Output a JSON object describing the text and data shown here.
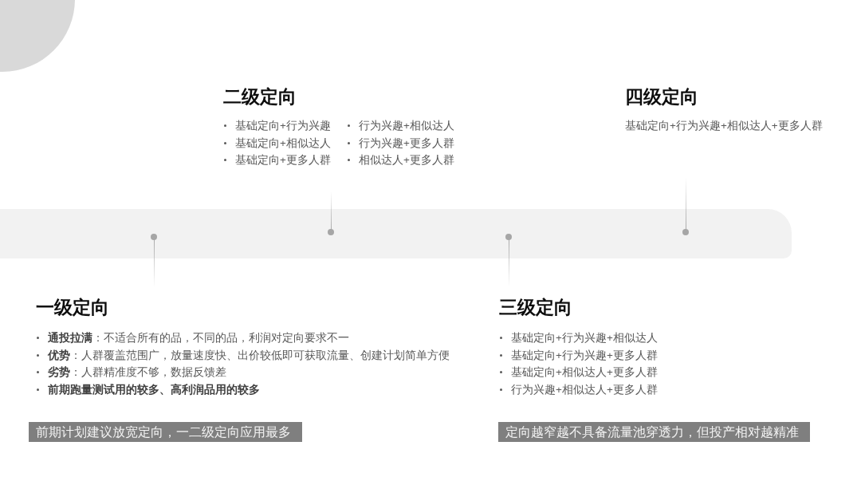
{
  "upper_stages": [
    {
      "title": "二级定向",
      "columns": [
        [
          "基础定向+行为兴趣",
          "基础定向+相似达人",
          "基础定向+更多人群"
        ],
        [
          "行为兴趣+相似达人",
          "行为兴趣+更多人群",
          "相似达人+更多人群"
        ]
      ]
    },
    {
      "title": "四级定向",
      "text": "基础定向+行为兴趣+相似达人+更多人群"
    }
  ],
  "lower_stages": [
    {
      "title": "一级定向",
      "bullets": [
        {
          "text": "**通投拉满**：不适合所有的品，不同的品，利润对定向要求不一",
          "emphasis": false
        },
        {
          "text": "**优势**：人群覆盖范围广，放量速度快、出价较低即可获取流量、创建计划简单方便",
          "emphasis": false
        },
        {
          "text": "**劣势**：人群精准度不够，数据反馈差",
          "emphasis": false
        },
        {
          "text": "前期跑量测试用的较多、高利润品用的较多",
          "emphasis": true
        }
      ],
      "note": "前期计划建议放宽定向，一二级定向应用最多"
    },
    {
      "title": "三级定向",
      "bullets": [
        {
          "text": "基础定向+行为兴趣+相似达人",
          "emphasis": false
        },
        {
          "text": "基础定向+行为兴趣+更多人群",
          "emphasis": false
        },
        {
          "text": "基础定向+相似达人+更多人群",
          "emphasis": false
        },
        {
          "text": "行为兴趣+相似达人+更多人群",
          "emphasis": false
        }
      ],
      "note": "定向越窄越不具备流量池穿透力，但投产相对越精准"
    }
  ]
}
